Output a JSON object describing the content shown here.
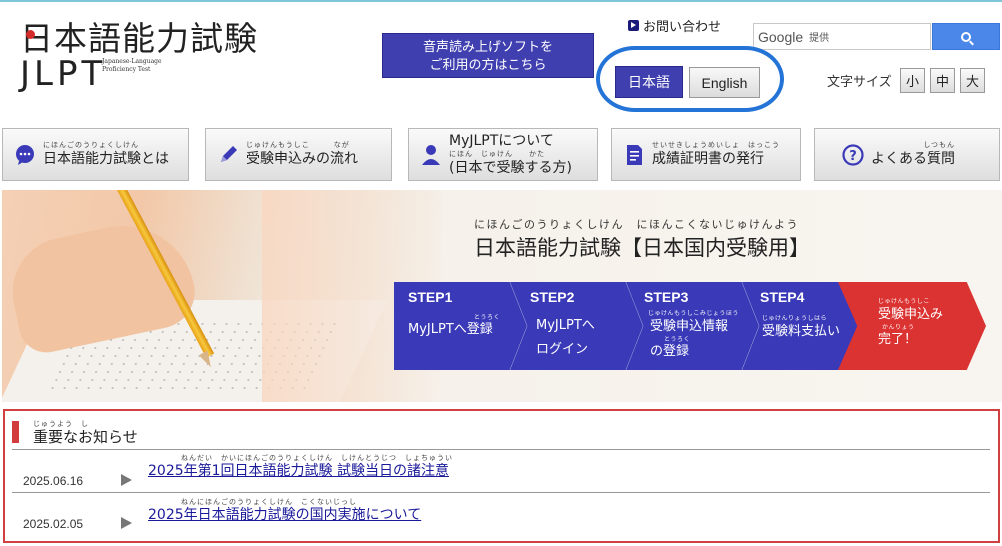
{
  "header": {
    "logo": {
      "title": "日本語能力試験",
      "abbr": "JLPT",
      "subtitle": "Japanese-Language Proficiency Test"
    },
    "tts_button": {
      "ruby": "おんせい よ あ",
      "line1": "音声読み上げソフトを",
      "line2": "ご利用の方はこちら",
      "line2_ruby": "りよう かた"
    },
    "contact": {
      "ruby": "と あ",
      "label": "お問い合わせ"
    },
    "search": {
      "brand": "Google",
      "powered": "提供",
      "button_icon": "search-icon"
    },
    "language": {
      "japanese": "日本語",
      "english": "English",
      "highlight_color": "#2474d8"
    },
    "font_size": {
      "label": "文字サイズ",
      "small": "小",
      "medium": "中",
      "large": "大"
    }
  },
  "nav": [
    {
      "icon": "chat-bubble-icon",
      "ruby": "にほんごのうりょくしけん",
      "label": "日本語能力試験とは"
    },
    {
      "icon": "pencil-icon",
      "ruby": "じゅけんもうしこ　　　なが",
      "label": "受験申込みの流れ"
    },
    {
      "icon": "person-icon",
      "ruby": "にほん　じゅけん　　かた",
      "label": "MyJLPTについて",
      "label2": "(日本で受験する方)"
    },
    {
      "icon": "document-icon",
      "ruby": "せいせきしょうめいしょ　はっこう",
      "label": "成績証明書の発行"
    },
    {
      "icon": "question-icon",
      "ruby": "しつもん",
      "label": "よくある質問"
    }
  ],
  "hero": {
    "ruby": "にほんごのうりょくしけん　にほんこくないじゅけんよう",
    "title": "日本語能力試験【日本国内受験用】",
    "steps": [
      {
        "num": "STEP1",
        "ruby": "とうろく",
        "lines": [
          "MyJLPTへ登録"
        ]
      },
      {
        "num": "STEP2",
        "ruby": "",
        "lines": [
          "MyJLPTへ",
          "ログイン"
        ]
      },
      {
        "num": "STEP3",
        "ruby": "じゅけんもうしこみじょうほう",
        "lines": [
          "受験申込情報",
          "の登録"
        ],
        "ruby2": "とうろく"
      },
      {
        "num": "STEP4",
        "ruby": "じゅけんりょうしはら",
        "lines": [
          "受験料支払い"
        ]
      },
      {
        "num": "",
        "ruby": "じゅけんもうしこ",
        "lines": [
          "受験申込み",
          "完了！"
        ],
        "ruby2": "かんりょう"
      }
    ],
    "colors": {
      "step": "#3a3ab8",
      "final_step": "#db3232"
    }
  },
  "notices": {
    "ruby": "じゅうよう　し",
    "title": "重要なお知らせ",
    "items": [
      {
        "date": "2025.06.16",
        "ruby": "ねんだい　かいにほんごのうりょくしけん　しけんとうじつ　しょちゅうい",
        "title": "2025年第1回日本語能力試験 試験当日の諸注意"
      },
      {
        "date": "2025.02.05",
        "ruby": "ねんにほんごのうりょくしけん　こくないじっし",
        "title": "2025年日本語能力試験の国内実施について"
      }
    ],
    "accent_color": "#d04040"
  }
}
